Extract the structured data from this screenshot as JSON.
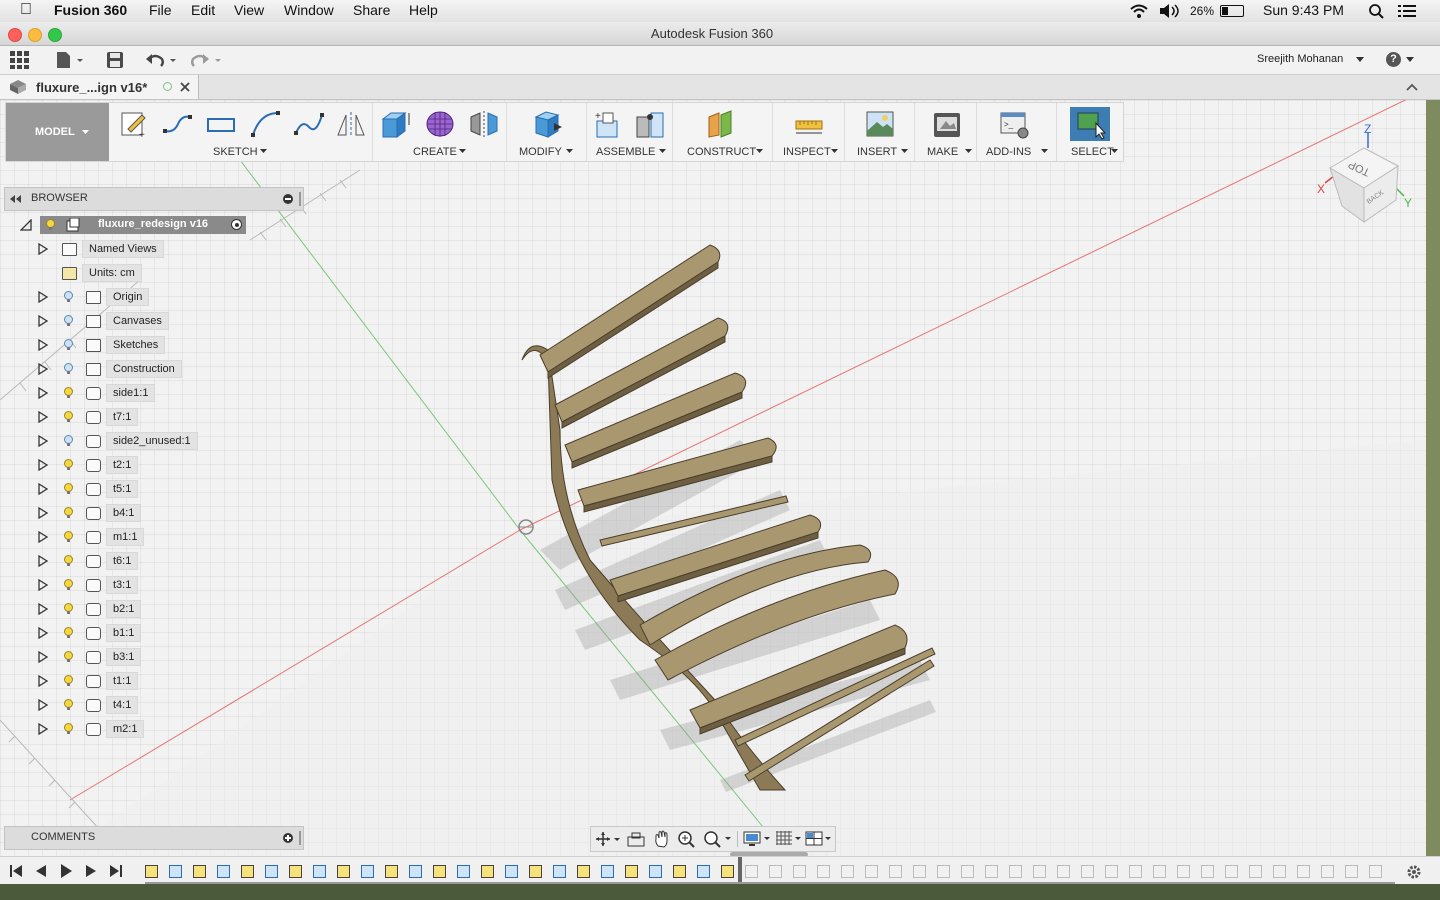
{
  "menubar": {
    "app_name": "Fusion 360",
    "menus": [
      "File",
      "Edit",
      "View",
      "Window",
      "Share",
      "Help"
    ],
    "battery": "26%",
    "clock": "Sun 9:43 PM"
  },
  "window": {
    "title": "Autodesk Fusion 360",
    "user": "Sreejith Mohanan",
    "help": "?"
  },
  "tab": {
    "document_name": "fluxure_...ign v16*"
  },
  "ribbon": {
    "workspace": "MODEL",
    "groups": [
      "SKETCH",
      "CREATE",
      "MODIFY",
      "ASSEMBLE",
      "CONSTRUCT",
      "INSPECT",
      "INSERT",
      "MAKE",
      "ADD-INS",
      "SELECT"
    ]
  },
  "browser": {
    "title": "BROWSER",
    "root": "fluxure_redesign v16",
    "items": [
      {
        "label": "Named Views",
        "type": "folder"
      },
      {
        "label": "Units: cm",
        "type": "units"
      },
      {
        "label": "Origin",
        "type": "folder"
      },
      {
        "label": "Canvases",
        "type": "folder"
      },
      {
        "label": "Sketches",
        "type": "folder"
      },
      {
        "label": "Construction",
        "type": "folder"
      },
      {
        "label": "side1:1",
        "type": "component"
      },
      {
        "label": "t7:1",
        "type": "component"
      },
      {
        "label": "side2_unused:1",
        "type": "component"
      },
      {
        "label": "t2:1",
        "type": "component"
      },
      {
        "label": "t5:1",
        "type": "component"
      },
      {
        "label": "b4:1",
        "type": "component"
      },
      {
        "label": "m1:1",
        "type": "component"
      },
      {
        "label": "t6:1",
        "type": "component"
      },
      {
        "label": "t3:1",
        "type": "component"
      },
      {
        "label": "b2:1",
        "type": "component"
      },
      {
        "label": "b1:1",
        "type": "component"
      },
      {
        "label": "b3:1",
        "type": "component"
      },
      {
        "label": "t1:1",
        "type": "component"
      },
      {
        "label": "t4:1",
        "type": "component"
      },
      {
        "label": "m2:1",
        "type": "component"
      }
    ]
  },
  "comments": {
    "title": "COMMENTS"
  },
  "viewcube": {
    "top": "TOP",
    "back": "BACK",
    "x": "X",
    "y": "Y",
    "z": "Z"
  },
  "colors": {
    "wood": "#8c7a56",
    "wood_light": "#a99770",
    "select_blue": "#3e7cb4",
    "axis_red": "#e04040",
    "axis_green": "#49b649"
  }
}
